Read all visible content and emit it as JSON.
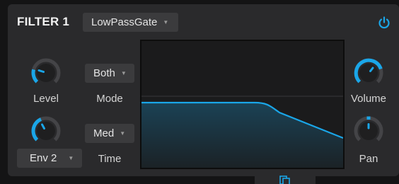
{
  "module": {
    "title": "FILTER 1",
    "filter_type": "LowPassGate",
    "power_on": true
  },
  "left_controls": {
    "level_label": "Level",
    "level_value": 0.15,
    "env_source": "Env 2",
    "env_amount_value": 0.38
  },
  "mid_controls": {
    "mode_value": "Both",
    "mode_label": "Mode",
    "time_value": "Med",
    "time_label": "Time"
  },
  "right_controls": {
    "volume_label": "Volume",
    "volume_value": 0.72,
    "pan_label": "Pan",
    "pan_value": 0.5
  },
  "colors": {
    "accent": "#1aa6e8",
    "panel": "#2a2a2c",
    "background": "#141415"
  },
  "icons": {
    "power": "power-icon",
    "dropdown": "chevron-down-icon",
    "bottom_tab": "copy-icon"
  }
}
